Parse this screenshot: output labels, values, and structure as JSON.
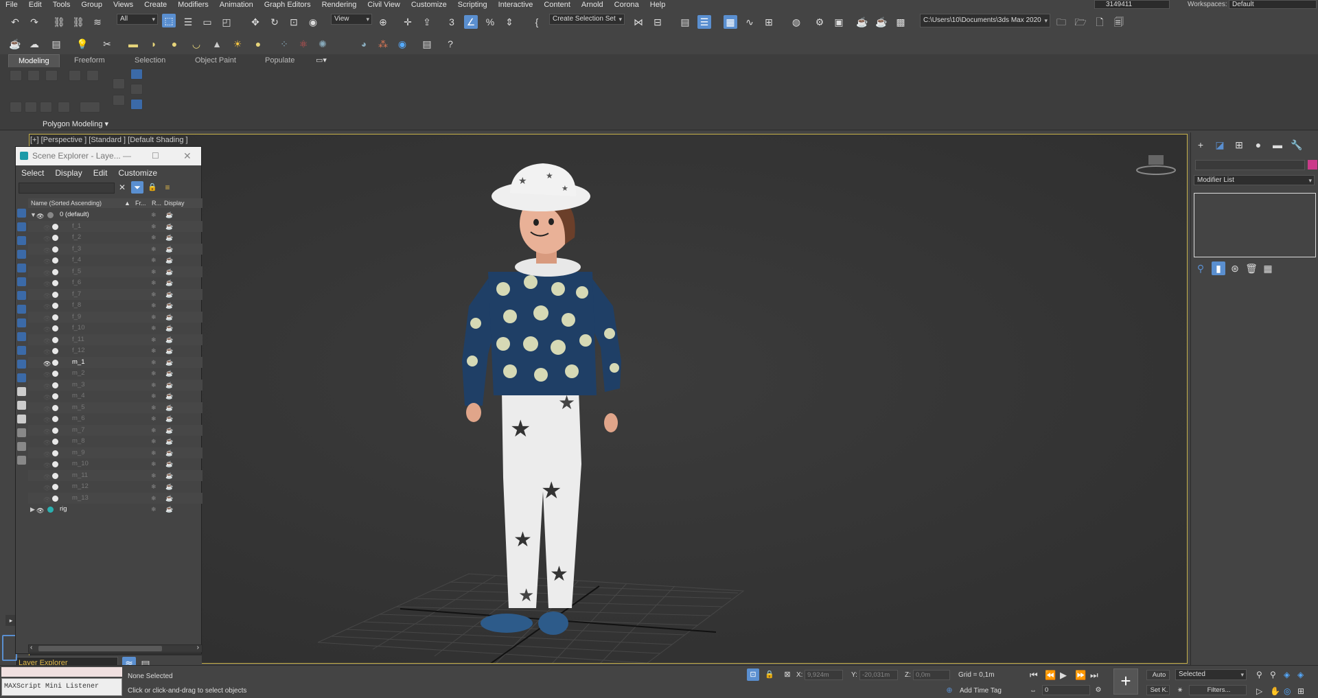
{
  "menubar": [
    "File",
    "Edit",
    "Tools",
    "Group",
    "Views",
    "Create",
    "Modifiers",
    "Animation",
    "Graph Editors",
    "Rendering",
    "Civil View",
    "Customize",
    "Scripting",
    "Interactive",
    "Content",
    "Arnold",
    "Corona",
    "Help"
  ],
  "user": "3149411",
  "workspaces": {
    "label": "Workspaces:",
    "value": "Default"
  },
  "toolbar": {
    "filter_value": "All",
    "view_value": "View",
    "selection_set": "Create Selection Set",
    "project_path": "C:\\Users\\10\\Documents\\3ds Max 2020"
  },
  "ribbon": {
    "tabs": [
      "Modeling",
      "Freeform",
      "Selection",
      "Object Paint",
      "Populate"
    ],
    "panel_label": "Polygon Modeling"
  },
  "viewport": {
    "label": "[+] [Perspective ] [Standard ] [Default Shading ]"
  },
  "scene_explorer": {
    "title": "Scene Explorer - Laye...",
    "menu": [
      "Select",
      "Display",
      "Edit",
      "Customize"
    ],
    "columns": {
      "name": "Name (Sorted Ascending)",
      "fr": "Fr...",
      "r": "R...",
      "display": "Display"
    },
    "root": "0 (default)",
    "items": [
      "f_1",
      "f_2",
      "f_3",
      "f_4",
      "f_5",
      "f_6",
      "f_7",
      "f_8",
      "f_9",
      "f_10",
      "f_11",
      "f_12",
      "m_1",
      "m_2",
      "m_3",
      "m_4",
      "m_5",
      "m_6",
      "m_7",
      "m_8",
      "m_9",
      "m_10",
      "m_11",
      "m_12",
      "m_13"
    ],
    "visible_item": "m_1",
    "rig": "rig"
  },
  "layer_explorer": "Layer Explorer",
  "command_panel": {
    "modifier_list": "Modifier List"
  },
  "status": {
    "maxscript": "MAXScript Mini Listener",
    "selection": "None Selected",
    "prompt": "Click or click-and-drag to select objects",
    "x_label": "X:",
    "x": "9,924m",
    "y_label": "Y:",
    "y": "-20,031m",
    "z_label": "Z:",
    "z": "0,0m",
    "grid": "Grid = 0,1m",
    "add_time_tag": "Add Time Tag",
    "auto": "Auto",
    "selected": "Selected",
    "set_key": "Set K.",
    "filters": "Filters...",
    "frame": "0"
  },
  "colors": {
    "viewport_border": "#c8b24a",
    "accent": "#5a8fd0",
    "layer_text": "#e0b84a"
  }
}
